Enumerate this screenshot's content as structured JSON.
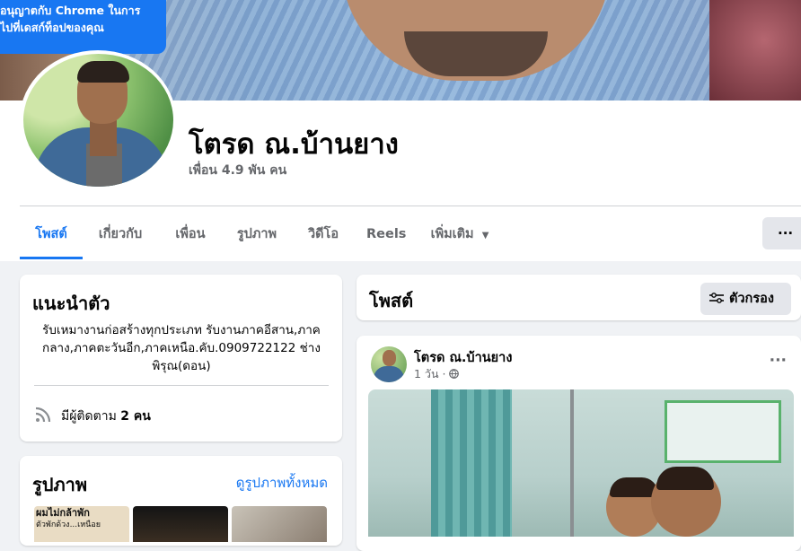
{
  "notification": {
    "line1": "อนุญาตกับ Chrome ในการ",
    "line2": "ไปที่เดสก์ท็อปของคุณ"
  },
  "profile": {
    "name": "โตรด ณ.บ้านยาง",
    "friends_count": "เพื่อน 4.9 พัน คน"
  },
  "tabs": [
    {
      "label": "โพสต์",
      "active": true
    },
    {
      "label": "เกี่ยวกับ"
    },
    {
      "label": "เพื่อน"
    },
    {
      "label": "รูปภาพ"
    },
    {
      "label": "วิดีโอ"
    },
    {
      "label": "Reels"
    },
    {
      "label": "เพิ่มเติม"
    }
  ],
  "more_menu": "···",
  "intro": {
    "title": "แนะนำตัว",
    "bio": "รับเหมางานก่อสร้างทุกประเภท รับงานภาคอีสาน,ภาคกลาง,ภาคตะวันอีก,ภาคเหนือ.คับ.0909722122 ช่างพิรุณ(ดอน)",
    "followers_prefix": "มีผู้ติดตาม",
    "followers_count": "2 คน"
  },
  "photos": {
    "title": "รูปภาพ",
    "see_all": "ดูรูปภาพทั้งหมด",
    "thumb1_text_line1": "ผมไม่กล้าพัก",
    "thumb1_text_line2": "ตัวพักด้วง...เหนือย"
  },
  "posts_header": {
    "title": "โพสต์",
    "filter_label": "ตัวกรอง"
  },
  "post": {
    "author": "โตรด ณ.บ้านยาง",
    "time": "1 วัน ·",
    "menu": "···"
  },
  "colors": {
    "accent": "#1877f2",
    "background": "#f0f2f5",
    "secondary_text": "#65676b"
  }
}
